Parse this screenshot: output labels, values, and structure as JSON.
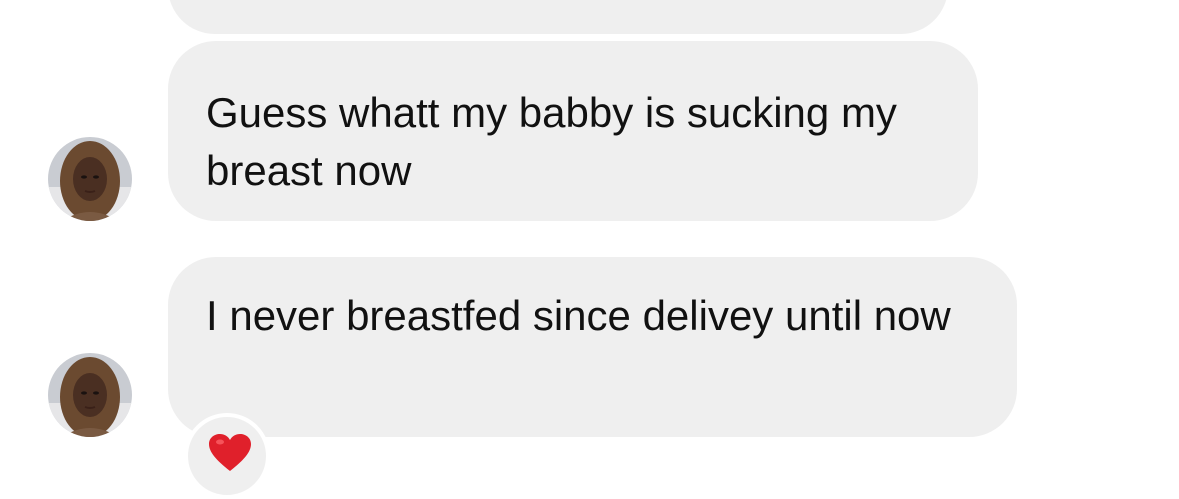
{
  "messages": [
    {
      "text": ""
    },
    {
      "text": "Guess whatt my babby is sucking my breast now"
    },
    {
      "text": "I never breastfed since delivey until now"
    }
  ],
  "reaction": {
    "icon": "red-heart-icon",
    "color": "#e0202b"
  },
  "colors": {
    "bubble": "#efefef",
    "text": "#111111",
    "background": "#ffffff"
  }
}
